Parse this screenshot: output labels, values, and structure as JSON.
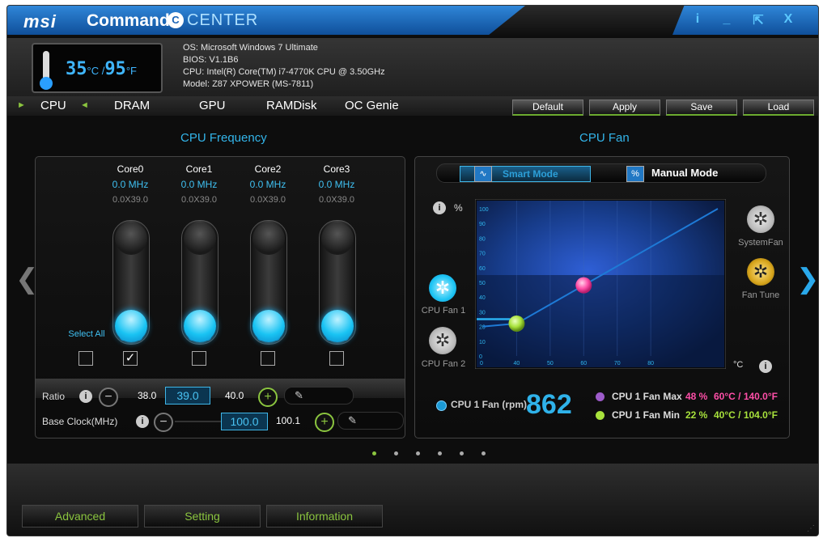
{
  "window": {
    "brand": "msi",
    "app_name_word1": "Command",
    "app_name_c": "C",
    "app_name_word2": "CENTER",
    "controls": {
      "info": "i",
      "minimize": "_",
      "restore": "⇱",
      "close": "X"
    }
  },
  "system": {
    "temp_c": "35",
    "temp_c_unit": "°C /",
    "temp_f": "95",
    "temp_f_unit": "°F",
    "os": "OS: Microsoft Windows 7 Ultimate",
    "bios": "BIOS: V1.1B6",
    "cpu": "CPU: Intel(R) Core(TM) i7-4770K CPU @ 3.50GHz",
    "model": "Model: Z87 XPOWER (MS-7811)"
  },
  "tabs": [
    "CPU",
    "DRAM",
    "GPU",
    "RAMDisk",
    "OC Genie"
  ],
  "tab_arrows": {
    "active": "►",
    "secondary": "◄"
  },
  "toolbar": {
    "default": "Default",
    "apply": "Apply",
    "save": "Save",
    "load": "Load"
  },
  "nav": {
    "prev": "❮",
    "next": "❯"
  },
  "cpu_frequency": {
    "title": "CPU Frequency",
    "cores": [
      {
        "name": "Core0",
        "freq": "0.0 MHz",
        "ratio": "0.0X39.0",
        "checked": true
      },
      {
        "name": "Core1",
        "freq": "0.0 MHz",
        "ratio": "0.0X39.0",
        "checked": false
      },
      {
        "name": "Core2",
        "freq": "0.0 MHz",
        "ratio": "0.0X39.0",
        "checked": false
      },
      {
        "name": "Core3",
        "freq": "0.0 MHz",
        "ratio": "0.0X39.0",
        "checked": false
      }
    ],
    "select_all": "Select All",
    "checkmark": "✓",
    "ratio": {
      "label": "Ratio",
      "min": "38.0",
      "value": "39.0",
      "max": "40.0"
    },
    "base_clock": {
      "label": "Base Clock(MHz)",
      "value": "100.0",
      "max": "100.1"
    }
  },
  "cpu_fan": {
    "title": "CPU Fan",
    "smart_mode": "Smart Mode",
    "manual_mode": "Manual Mode",
    "smart_icon": "∿",
    "manual_icon": "%",
    "y_unit": "%",
    "x_unit": "°C",
    "fans_left": [
      "CPU Fan 1",
      "CPU Fan 2"
    ],
    "fans_right": [
      "SystemFan",
      "Fan Tune"
    ],
    "rpm_label": "CPU 1 Fan (rpm)",
    "rpm_value": "862",
    "max": {
      "label": "CPU 1 Fan Max",
      "percent": "48 %",
      "temp": "60°C / 140.0°F",
      "color": "#ff4fa8"
    },
    "min": {
      "label": "CPU 1 Fan Min",
      "percent": "22 %",
      "temp": "40°C / 104.0°F",
      "color": "#a8e23c"
    }
  },
  "chart_data": {
    "type": "line",
    "x_ticks": [
      "0",
      "40",
      "50",
      "60",
      "70",
      "80"
    ],
    "y_ticks": [
      "0",
      "10",
      "20",
      "30",
      "40",
      "50",
      "60",
      "70",
      "80",
      "90",
      "100"
    ],
    "points": [
      {
        "x": 40,
        "y": 22
      },
      {
        "x": 60,
        "y": 48
      },
      {
        "x": 100,
        "y": 100
      }
    ]
  },
  "page_count": 6,
  "active_page": 0,
  "bottom": {
    "advanced": "Advanced",
    "setting": "Setting",
    "information": "Information"
  },
  "colors": {
    "accent_blue": "#33b5ea",
    "accent_green": "#8bc53f"
  }
}
